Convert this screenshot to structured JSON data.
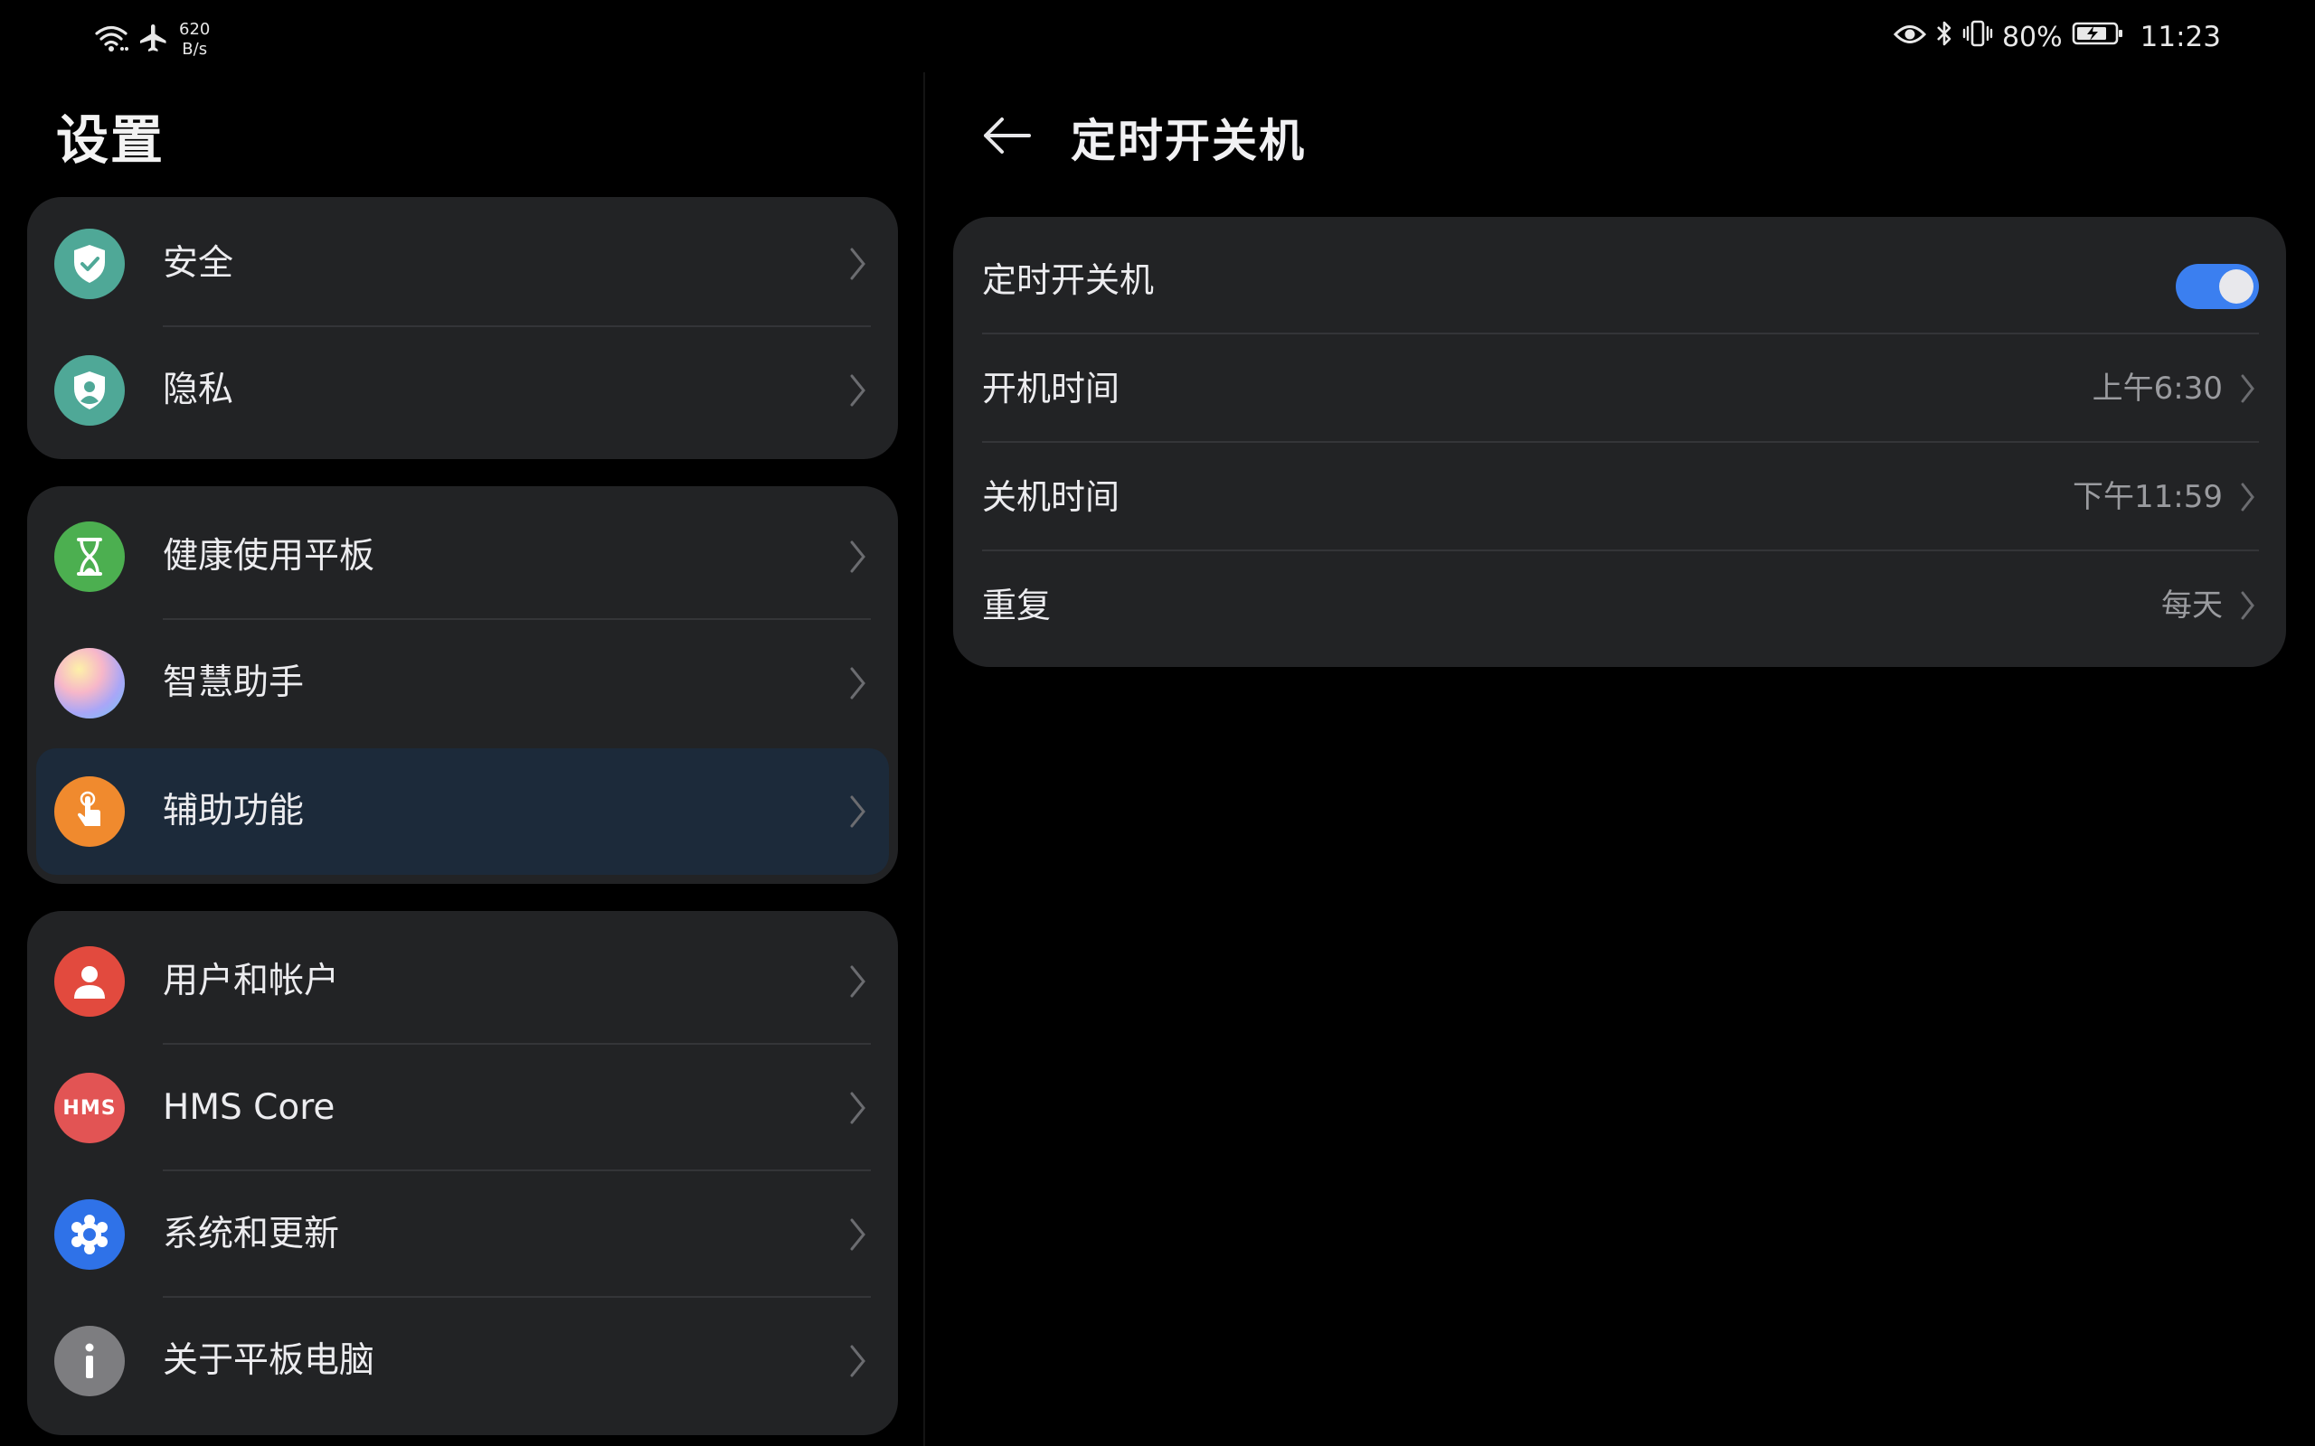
{
  "status_bar": {
    "net_speed_value": "620",
    "net_speed_unit": "B/s",
    "battery_percent": "80%",
    "time": "11:23"
  },
  "sidebar": {
    "title": "设置",
    "groups": [
      {
        "items": [
          {
            "label": "安全",
            "icon": "shield-check-icon",
            "color": "#4fa897"
          },
          {
            "label": "隐私",
            "icon": "privacy-shield-icon",
            "color": "#4fa897"
          }
        ]
      },
      {
        "items": [
          {
            "label": "健康使用平板",
            "icon": "hourglass-icon",
            "color": "#4caf50"
          },
          {
            "label": "智慧助手",
            "icon": "smart-assistant-icon",
            "color": "#c79bf0"
          },
          {
            "label": "辅助功能",
            "icon": "hand-touch-icon",
            "color": "#f08a2e",
            "selected": true
          }
        ]
      },
      {
        "items": [
          {
            "label": "用户和帐户",
            "icon": "user-icon",
            "color": "#e24a3e"
          },
          {
            "label": "HMS Core",
            "icon": "hms-icon",
            "icon_text": "HMS",
            "color": "#e25454"
          },
          {
            "label": "系统和更新",
            "icon": "gear-icon",
            "color": "#2f72e8"
          },
          {
            "label": "关于平板电脑",
            "icon": "info-icon",
            "color": "#7d7d80"
          }
        ]
      }
    ]
  },
  "detail": {
    "title": "定时开关机",
    "rows": [
      {
        "label": "定时开关机",
        "toggle_on": true
      },
      {
        "label": "开机时间",
        "value": "上午6:30"
      },
      {
        "label": "关机时间",
        "value": "下午11:59"
      },
      {
        "label": "重复",
        "value": "每天"
      }
    ],
    "accent_color": "#3b7ff0"
  }
}
